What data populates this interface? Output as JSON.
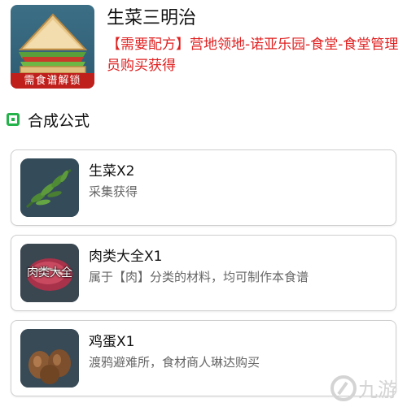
{
  "item": {
    "title": "生菜三明治",
    "lock_badge": "需食谱解锁",
    "recipe_note": "【需要配方】营地领地-诺亚乐园-食堂-食堂管理员购买获得",
    "image_icon": "sandwich-icon"
  },
  "section": {
    "title": "合成公式",
    "icon": "section-square-icon",
    "accent_color": "#24b24a"
  },
  "ingredients": [
    {
      "name": "生菜X2",
      "desc": "采集获得",
      "icon": "lettuce-icon"
    },
    {
      "name": "肉类大全X1",
      "desc": "属于【肉】分类的材料，均可制作本食谱",
      "icon": "meat-icon",
      "overlay": "肉类大全"
    },
    {
      "name": "鸡蛋X1",
      "desc": "渡鸦避难所，食材商人琳达购买",
      "icon": "eggs-icon"
    }
  ],
  "watermark": {
    "text": "九游",
    "icon": "9game-logo-icon"
  },
  "colors": {
    "note_red": "#e02020",
    "badge_red": "#c0201c"
  }
}
